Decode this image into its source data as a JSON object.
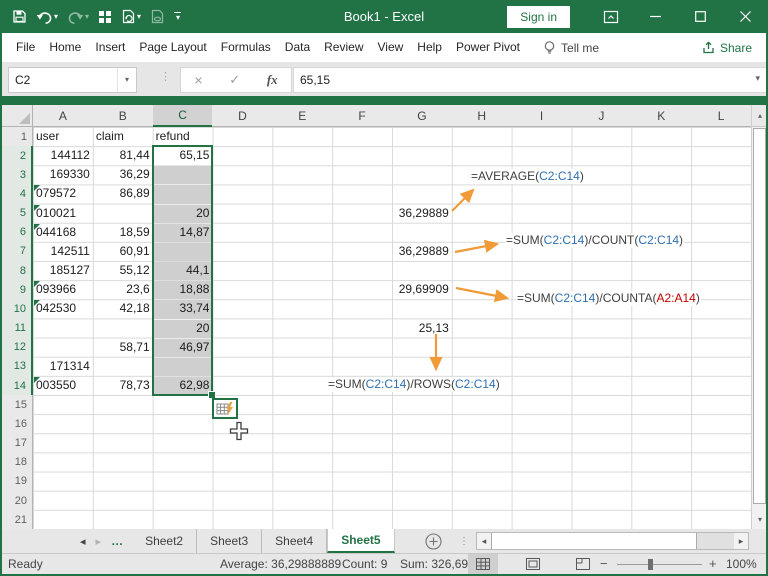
{
  "titlebar": {
    "title": "Book1 - Excel",
    "sign_in": "Sign in"
  },
  "ribbon": {
    "tabs": [
      "File",
      "Home",
      "Insert",
      "Page Layout",
      "Formulas",
      "Data",
      "Review",
      "View",
      "Help",
      "Power Pivot"
    ],
    "tell_me": "Tell me",
    "share": "Share"
  },
  "formula_bar": {
    "name_box": "C2",
    "fx_label": "fx",
    "cancel": "×",
    "enter": "✓",
    "value": "65,15"
  },
  "grid": {
    "col_headers": [
      "A",
      "B",
      "C",
      "D",
      "E",
      "F",
      "G",
      "H",
      "I",
      "J",
      "K",
      "L"
    ],
    "selected_col": "C",
    "num_rows": 21,
    "selection": {
      "col": "C",
      "from_row": 2,
      "to_row": 14,
      "active_row": 2
    },
    "cells": [
      {
        "r": 1,
        "c": "A",
        "v": "user",
        "a": "l"
      },
      {
        "r": 1,
        "c": "B",
        "v": "claim",
        "a": "l"
      },
      {
        "r": 1,
        "c": "C",
        "v": "refund",
        "a": "l"
      },
      {
        "r": 2,
        "c": "A",
        "v": "144112",
        "a": "r"
      },
      {
        "r": 2,
        "c": "B",
        "v": "81,44",
        "a": "r"
      },
      {
        "r": 2,
        "c": "C",
        "v": "65,15",
        "a": "r"
      },
      {
        "r": 3,
        "c": "A",
        "v": "169330",
        "a": "r"
      },
      {
        "r": 3,
        "c": "B",
        "v": "36,29",
        "a": "r"
      },
      {
        "r": 4,
        "c": "A",
        "v": "079572",
        "a": "l",
        "e": true
      },
      {
        "r": 4,
        "c": "B",
        "v": "86,89",
        "a": "r"
      },
      {
        "r": 5,
        "c": "A",
        "v": "010021",
        "a": "l",
        "e": true
      },
      {
        "r": 5,
        "c": "C",
        "v": "20",
        "a": "r"
      },
      {
        "r": 5,
        "c": "G",
        "v": "36,29889",
        "a": "r"
      },
      {
        "r": 6,
        "c": "A",
        "v": "044168",
        "a": "l",
        "e": true
      },
      {
        "r": 6,
        "c": "B",
        "v": "18,59",
        "a": "r"
      },
      {
        "r": 6,
        "c": "C",
        "v": "14,87",
        "a": "r"
      },
      {
        "r": 7,
        "c": "A",
        "v": "142511",
        "a": "r"
      },
      {
        "r": 7,
        "c": "B",
        "v": "60,91",
        "a": "r"
      },
      {
        "r": 7,
        "c": "G",
        "v": "36,29889",
        "a": "r"
      },
      {
        "r": 8,
        "c": "A",
        "v": "185127",
        "a": "r"
      },
      {
        "r": 8,
        "c": "B",
        "v": "55,12",
        "a": "r"
      },
      {
        "r": 8,
        "c": "C",
        "v": "44,1",
        "a": "r"
      },
      {
        "r": 9,
        "c": "A",
        "v": "093966",
        "a": "l",
        "e": true
      },
      {
        "r": 9,
        "c": "B",
        "v": "23,6",
        "a": "r"
      },
      {
        "r": 9,
        "c": "C",
        "v": "18,88",
        "a": "r"
      },
      {
        "r": 9,
        "c": "G",
        "v": "29,69909",
        "a": "r"
      },
      {
        "r": 10,
        "c": "A",
        "v": "042530",
        "a": "l",
        "e": true
      },
      {
        "r": 10,
        "c": "B",
        "v": "42,18",
        "a": "r"
      },
      {
        "r": 10,
        "c": "C",
        "v": "33,74",
        "a": "r"
      },
      {
        "r": 11,
        "c": "C",
        "v": "20",
        "a": "r"
      },
      {
        "r": 11,
        "c": "G",
        "v": "25,13",
        "a": "r"
      },
      {
        "r": 12,
        "c": "B",
        "v": "58,71",
        "a": "r"
      },
      {
        "r": 12,
        "c": "C",
        "v": "46,97",
        "a": "r"
      },
      {
        "r": 13,
        "c": "A",
        "v": "171314",
        "a": "r"
      },
      {
        "r": 14,
        "c": "A",
        "v": "003550",
        "a": "l",
        "e": true
      },
      {
        "r": 14,
        "c": "B",
        "v": "78,73",
        "a": "r"
      },
      {
        "r": 14,
        "c": "C",
        "v": "62,98",
        "a": "r"
      }
    ]
  },
  "annotations": {
    "formulas": [
      {
        "parts": [
          {
            "t": "=AVERAGE(",
            "k": "d"
          },
          {
            "t": "C2:C14",
            "k": "b"
          },
          {
            "t": ")",
            "k": "d"
          }
        ]
      },
      {
        "parts": [
          {
            "t": "=SUM(",
            "k": "d"
          },
          {
            "t": "C2:C14",
            "k": "b"
          },
          {
            "t": ")/COUNT(",
            "k": "d"
          },
          {
            "t": "C2:C14",
            "k": "b"
          },
          {
            "t": ")",
            "k": "d"
          }
        ]
      },
      {
        "parts": [
          {
            "t": "=SUM(",
            "k": "d"
          },
          {
            "t": "C2:C14",
            "k": "b"
          },
          {
            "t": ")/COUNTA(",
            "k": "d"
          },
          {
            "t": "A2:A14",
            "k": "r"
          },
          {
            "t": ")",
            "k": "d"
          }
        ]
      },
      {
        "parts": [
          {
            "t": "=SUM(",
            "k": "d"
          },
          {
            "t": "C2:C14",
            "k": "b"
          },
          {
            "t": ")/ROWS(",
            "k": "d"
          },
          {
            "t": "C2:C14",
            "k": "b"
          },
          {
            "t": ")",
            "k": "d"
          }
        ]
      }
    ],
    "arrow_color": "#F09B37"
  },
  "sheet_tabs": {
    "more_indicator": "…",
    "tabs": [
      "Sheet2",
      "Sheet3",
      "Sheet4",
      "Sheet5"
    ],
    "active": "Sheet5"
  },
  "status_bar": {
    "ready": "Ready",
    "average": "Average: 36,29888889",
    "count": "Count: 9",
    "sum": "Sum: 326,69",
    "zoom_level": "100%"
  },
  "colors": {
    "brand_green": "#217346",
    "selection_gray": "#CFCFCF",
    "ref_blue": "#2E6FB0",
    "ref_red": "#C00000"
  }
}
